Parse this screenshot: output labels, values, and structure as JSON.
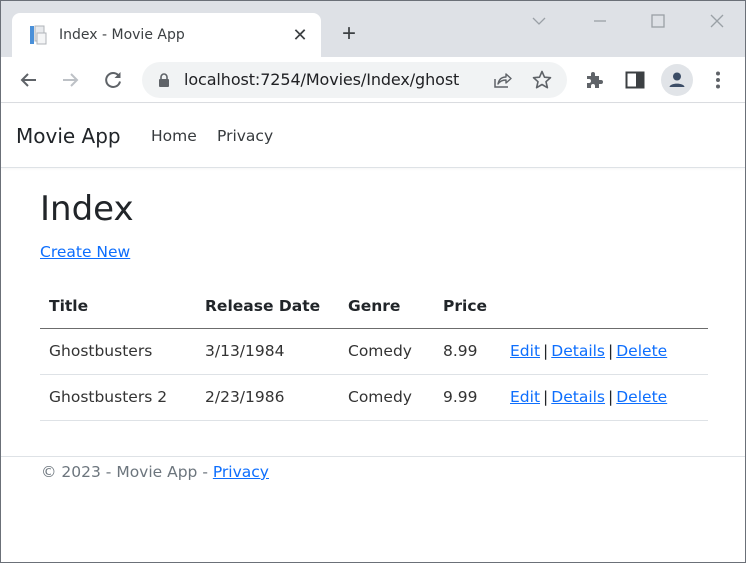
{
  "browser": {
    "tab": {
      "title": "Index - Movie App",
      "favicon": "document-favicon-icon",
      "close_glyph": "✕"
    },
    "new_tab_glyph": "+",
    "window_controls": [
      "tab-search",
      "minimize",
      "maximize",
      "close"
    ],
    "address_bar": {
      "url": "localhost:7254/Movies/Index/ghost"
    }
  },
  "navbar": {
    "brand": "Movie App",
    "links": [
      {
        "label": "Home"
      },
      {
        "label": "Privacy"
      }
    ]
  },
  "main": {
    "heading": "Index",
    "create_new_label": "Create New",
    "table": {
      "headers": [
        "Title",
        "Release Date",
        "Genre",
        "Price",
        ""
      ],
      "rows": [
        {
          "title": "Ghostbusters",
          "release_date": "3/13/1984",
          "genre": "Comedy",
          "price": "8.99"
        },
        {
          "title": "Ghostbusters 2",
          "release_date": "2/23/1986",
          "genre": "Comedy",
          "price": "9.99"
        }
      ],
      "actions": {
        "edit": "Edit",
        "details": "Details",
        "delete": "Delete",
        "separator": "|"
      }
    }
  },
  "footer": {
    "text": "© 2023 - Movie App - ",
    "privacy_label": "Privacy"
  },
  "colors": {
    "link": "#0d6efd",
    "text": "#212529",
    "muted": "#6c757d",
    "tabstrip": "#dee1e6"
  }
}
